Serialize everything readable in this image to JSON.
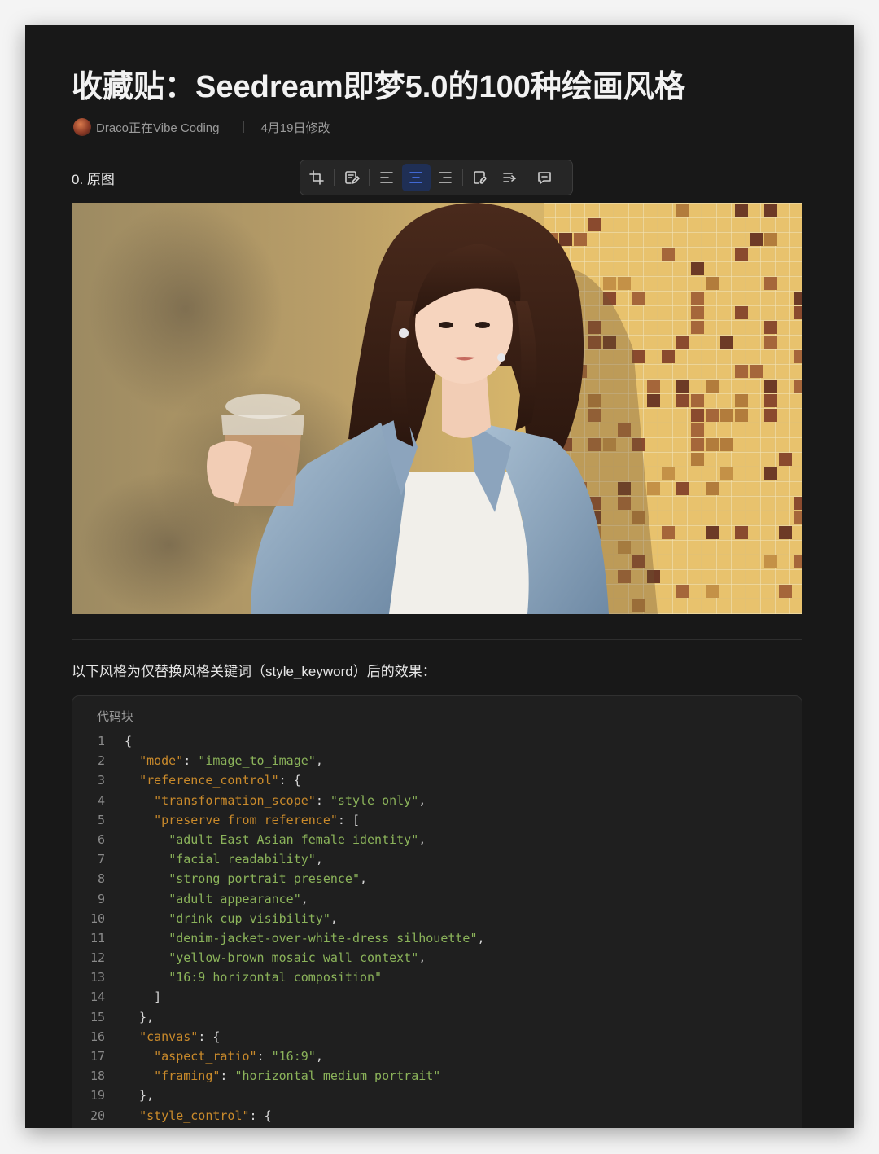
{
  "doc": {
    "title": "收藏贴：Seedream即梦5.0的100种绘画风格",
    "author": "Draco正在Vibe Coding",
    "modified": "4月19日修改"
  },
  "section": {
    "heading": "0. 原图"
  },
  "toolbar": {
    "buttons": [
      {
        "name": "crop-button",
        "icon": "crop-icon",
        "active": false
      },
      {
        "name": "edit-image-button",
        "icon": "edit-icon",
        "active": false
      },
      {
        "name": "align-left-button",
        "icon": "align-left-icon",
        "active": false
      },
      {
        "name": "align-center-button",
        "icon": "align-center-icon",
        "active": true
      },
      {
        "name": "align-right-button",
        "icon": "align-right-icon",
        "active": false
      },
      {
        "name": "link-button",
        "icon": "link-icon",
        "active": false
      },
      {
        "name": "text-wrap-button",
        "icon": "text-wrap-icon",
        "active": false
      },
      {
        "name": "comment-button",
        "icon": "comment-icon",
        "active": false
      }
    ],
    "accent_color": "#4d7cff"
  },
  "intro_text": "以下风格为仅替换风格关键词（style_keyword）后的效果：",
  "code_block": {
    "label": "代码块",
    "lines": [
      {
        "n": "1",
        "tokens": [
          [
            "p",
            "{"
          ]
        ]
      },
      {
        "n": "2",
        "tokens": [
          [
            "p",
            "  "
          ],
          [
            "k",
            "\"mode\""
          ],
          [
            "p",
            ": "
          ],
          [
            "s",
            "\"image_to_image\""
          ],
          [
            "p",
            ","
          ]
        ]
      },
      {
        "n": "3",
        "tokens": [
          [
            "p",
            "  "
          ],
          [
            "k",
            "\"reference_control\""
          ],
          [
            "p",
            ": {"
          ]
        ]
      },
      {
        "n": "4",
        "tokens": [
          [
            "p",
            "    "
          ],
          [
            "k",
            "\"transformation_scope\""
          ],
          [
            "p",
            ": "
          ],
          [
            "s",
            "\"style only\""
          ],
          [
            "p",
            ","
          ]
        ]
      },
      {
        "n": "5",
        "tokens": [
          [
            "p",
            "    "
          ],
          [
            "k",
            "\"preserve_from_reference\""
          ],
          [
            "p",
            ": ["
          ]
        ]
      },
      {
        "n": "6",
        "tokens": [
          [
            "p",
            "      "
          ],
          [
            "s",
            "\"adult East Asian female identity\""
          ],
          [
            "p",
            ","
          ]
        ]
      },
      {
        "n": "7",
        "tokens": [
          [
            "p",
            "      "
          ],
          [
            "s",
            "\"facial readability\""
          ],
          [
            "p",
            ","
          ]
        ]
      },
      {
        "n": "8",
        "tokens": [
          [
            "p",
            "      "
          ],
          [
            "s",
            "\"strong portrait presence\""
          ],
          [
            "p",
            ","
          ]
        ]
      },
      {
        "n": "9",
        "tokens": [
          [
            "p",
            "      "
          ],
          [
            "s",
            "\"adult appearance\""
          ],
          [
            "p",
            ","
          ]
        ]
      },
      {
        "n": "10",
        "tokens": [
          [
            "p",
            "      "
          ],
          [
            "s",
            "\"drink cup visibility\""
          ],
          [
            "p",
            ","
          ]
        ]
      },
      {
        "n": "11",
        "tokens": [
          [
            "p",
            "      "
          ],
          [
            "s",
            "\"denim-jacket-over-white-dress silhouette\""
          ],
          [
            "p",
            ","
          ]
        ]
      },
      {
        "n": "12",
        "tokens": [
          [
            "p",
            "      "
          ],
          [
            "s",
            "\"yellow-brown mosaic wall context\""
          ],
          [
            "p",
            ","
          ]
        ]
      },
      {
        "n": "13",
        "tokens": [
          [
            "p",
            "      "
          ],
          [
            "s",
            "\"16:9 horizontal composition\""
          ]
        ]
      },
      {
        "n": "14",
        "tokens": [
          [
            "p",
            "    ]"
          ]
        ]
      },
      {
        "n": "15",
        "tokens": [
          [
            "p",
            "  },"
          ]
        ]
      },
      {
        "n": "16",
        "tokens": [
          [
            "p",
            "  "
          ],
          [
            "k",
            "\"canvas\""
          ],
          [
            "p",
            ": {"
          ]
        ]
      },
      {
        "n": "17",
        "tokens": [
          [
            "p",
            "    "
          ],
          [
            "k",
            "\"aspect_ratio\""
          ],
          [
            "p",
            ": "
          ],
          [
            "s",
            "\"16:9\""
          ],
          [
            "p",
            ","
          ]
        ]
      },
      {
        "n": "18",
        "tokens": [
          [
            "p",
            "    "
          ],
          [
            "k",
            "\"framing\""
          ],
          [
            "p",
            ": "
          ],
          [
            "s",
            "\"horizontal medium portrait\""
          ]
        ]
      },
      {
        "n": "19",
        "tokens": [
          [
            "p",
            "  },"
          ]
        ]
      },
      {
        "n": "20",
        "tokens": [
          [
            "p",
            "  "
          ],
          [
            "k",
            "\"style_control\""
          ],
          [
            "p",
            ": {"
          ]
        ]
      }
    ],
    "colors": {
      "key": "#c98a2b",
      "string": "#8bb35a",
      "punct": "#d6d6d6"
    }
  }
}
